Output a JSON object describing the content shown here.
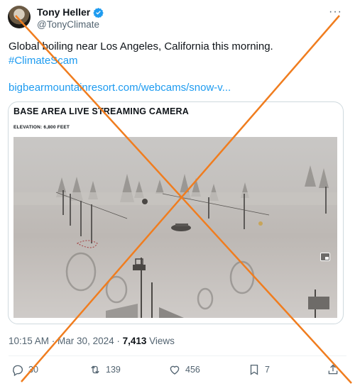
{
  "author": {
    "display_name": "Tony Heller",
    "handle": "@TonyClimate"
  },
  "more_label": "···",
  "tweet": {
    "text": "Global boiling near Los Angeles, California this morning.",
    "hashtag": "#ClimateScam",
    "link": "bigbearmountainresort.com/webcams/snow-v..."
  },
  "card": {
    "title": "BASE AREA LIVE STREAMING CAMERA",
    "elevation": "ELEVATION: 6,800 FEET"
  },
  "meta": {
    "time": "10:15 AM",
    "separator": " · ",
    "date": "Mar 30, 2024",
    "separator2": " · ",
    "views_count": "7,413",
    "views_label": " Views"
  },
  "actions": {
    "replies": "30",
    "reposts": "139",
    "likes": "456",
    "bookmarks": "7"
  },
  "colors": {
    "accent": "#1d9bf0",
    "cross": "#f07d1f"
  }
}
